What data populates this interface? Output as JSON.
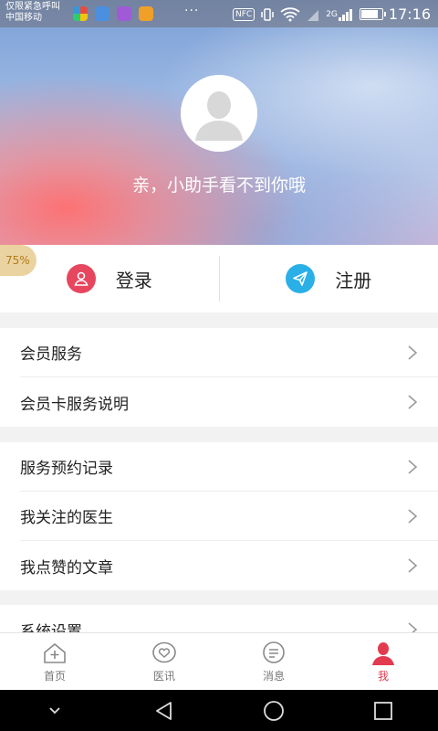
{
  "status_bar": {
    "carrier_line1": "仅限紧急呼叫",
    "carrier_line2": "中国移动",
    "more": "···",
    "nfc": "NFC",
    "network": "2G",
    "time": "17:16",
    "battery_level": 0.85
  },
  "profile": {
    "prompt": "亲，小助手看不到你哦"
  },
  "auth": {
    "login_label": "登录",
    "register_label": "注册",
    "login_color": "#e6475e",
    "register_color": "#2ab0e6"
  },
  "badge": {
    "text": "75%"
  },
  "groups": [
    {
      "items": [
        "会员服务",
        "会员卡服务说明"
      ]
    },
    {
      "items": [
        "服务预约记录",
        "我关注的医生",
        "我点赞的文章"
      ]
    },
    {
      "items": [
        "系统设置"
      ]
    }
  ],
  "tabs": [
    {
      "label": "首页",
      "icon": "home-plus-icon"
    },
    {
      "label": "医讯",
      "icon": "heart-bubble-icon"
    },
    {
      "label": "消息",
      "icon": "message-icon"
    },
    {
      "label": "我",
      "icon": "person-icon",
      "active": true
    }
  ],
  "colors": {
    "accent": "#e23b4f",
    "background": "#f2f2f2"
  }
}
